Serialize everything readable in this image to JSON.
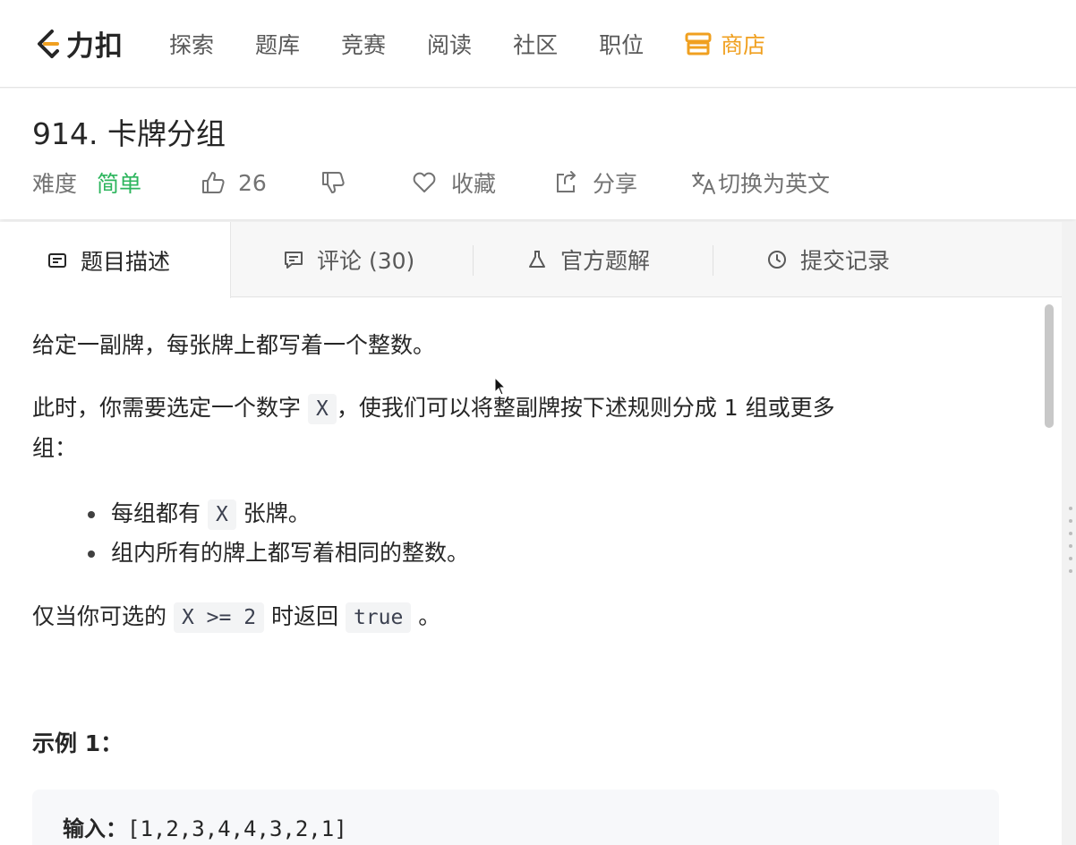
{
  "nav": {
    "logo_text": "力扣",
    "items": [
      "探索",
      "题库",
      "竞赛",
      "阅读",
      "社区",
      "职位"
    ],
    "store_label": "商店",
    "store_color": "#f0a020"
  },
  "problem": {
    "title": "914. 卡牌分组",
    "difficulty_label": "难度",
    "difficulty_value": "简单",
    "difficulty_color": "#2db55d",
    "likes": "26",
    "favorite_label": "收藏",
    "share_label": "分享",
    "lang_switch_label": "切换为英文"
  },
  "tabs": [
    {
      "label": "题目描述",
      "icon": "description-icon",
      "active": true
    },
    {
      "label": "评论 (30)",
      "icon": "comment-icon",
      "active": false
    },
    {
      "label": "官方题解",
      "icon": "flask-icon",
      "active": false
    },
    {
      "label": "提交记录",
      "icon": "clock-icon",
      "active": false
    }
  ],
  "description": {
    "p1": "给定一副牌，每张牌上都写着一个整数。",
    "p2_before": "此时，你需要选定一个数字 ",
    "p2_code": "X",
    "p2_after": "，使我们可以将整副牌按下述规则分成 1 组或更多",
    "p2_line2": "组：",
    "bullet1_before": "每组都有 ",
    "bullet1_code": "X",
    "bullet1_after": " 张牌。",
    "bullet2": "组内所有的牌上都写着相同的整数。",
    "p3_before": "仅当你可选的 ",
    "p3_code1": "X >= 2",
    "p3_mid": " 时返回 ",
    "p3_code2": "true",
    "p3_after": " 。",
    "example_heading": "示例 1：",
    "example_input_label": "输入：",
    "example_input_value": "[1,2,3,4,4,3,2,1]"
  }
}
